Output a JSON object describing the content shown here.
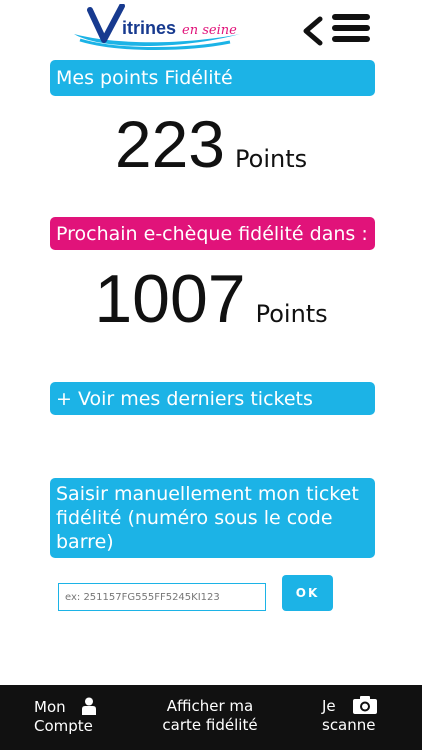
{
  "header": {
    "logo_text": "Vitrines en seine",
    "logo_script": "en seine",
    "back_icon": "chevron-left-icon",
    "menu_icon": "hamburger-menu-icon"
  },
  "loyalty": {
    "title": "Mes points Fidélité",
    "points_value": "223",
    "points_unit": "Points"
  },
  "next_cheque": {
    "title": "Prochain e-chèque fidélité dans :",
    "points_value": "1007",
    "points_unit": "Points"
  },
  "tickets": {
    "link_label": "+ Voir mes derniers tickets"
  },
  "manual_entry": {
    "title": "Saisir manuellement mon ticket fidélité (numéro sous le code barre)",
    "input_value": "",
    "input_placeholder": "ex: 251157FG555FF5245KI123",
    "ok_label": "OK"
  },
  "bottom_nav": {
    "account_line1": "Mon",
    "account_line2": "Compte",
    "card_line1": "Afficher ma",
    "card_line2": "carte fidélité",
    "scan_line1": "Je",
    "scan_line2": "scanne"
  },
  "colors": {
    "accent_blue": "#1cb3e6",
    "accent_pink": "#e1137a",
    "nav_background": "#111111"
  }
}
